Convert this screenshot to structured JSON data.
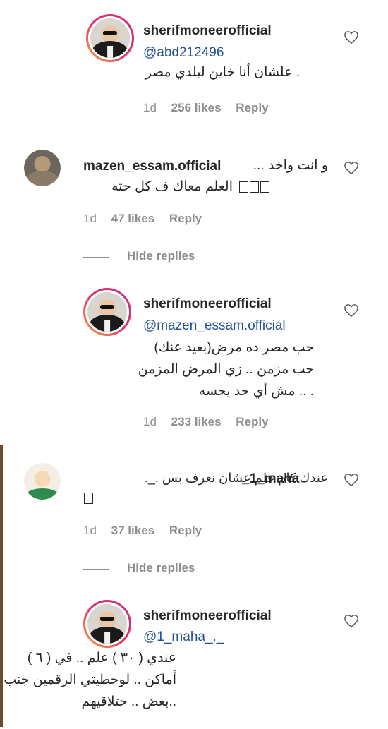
{
  "comments": [
    {
      "username": "sherifmoneerofficial",
      "mention": "@abd212496",
      "lines": [
        ". علشان أنا خاين لبلدي مصر"
      ],
      "time": "1d",
      "likes": "256 likes",
      "reply": "Reply"
    },
    {
      "username": "mazen_essam.official",
      "lines": [
        "و انت واخد ...",
        "العلم معاك ف كل حته"
      ],
      "time": "1d",
      "likes": "47 likes",
      "reply": "Reply",
      "hide_replies": "Hide replies"
    },
    {
      "username": "sherifmoneerofficial",
      "mention": "@mazen_essam.official",
      "lines": [
        "حب مصر ده مرض(بعيد عنك)",
        "حب مزمن .. زي المرض المزمن",
        ". .. مش أي حد يحسه"
      ],
      "time": "1d",
      "likes": "233 likes",
      "reply": "Reply"
    },
    {
      "username": "_1_maha",
      "lines": [
        "عندك كام علم عشان نعرف بس ._."
      ],
      "time": "1d",
      "likes": "37 likes",
      "reply": "Reply",
      "hide_replies": "Hide replies"
    },
    {
      "username": "sherifmoneerofficial",
      "mention": "@1_maha_._",
      "lines": [
        "عندي ( ٣٠ ) علم .. في ( ٦ )",
        "أماكن .. لوحطيتي الرقمين جنب",
        "..بعض .. حتلاقيهم"
      ]
    }
  ],
  "icons": {
    "heart": "heart-outline-icon"
  },
  "colors": {
    "mention": "#1f4f95",
    "meta": "#8e8e8e",
    "text": "#262626"
  }
}
